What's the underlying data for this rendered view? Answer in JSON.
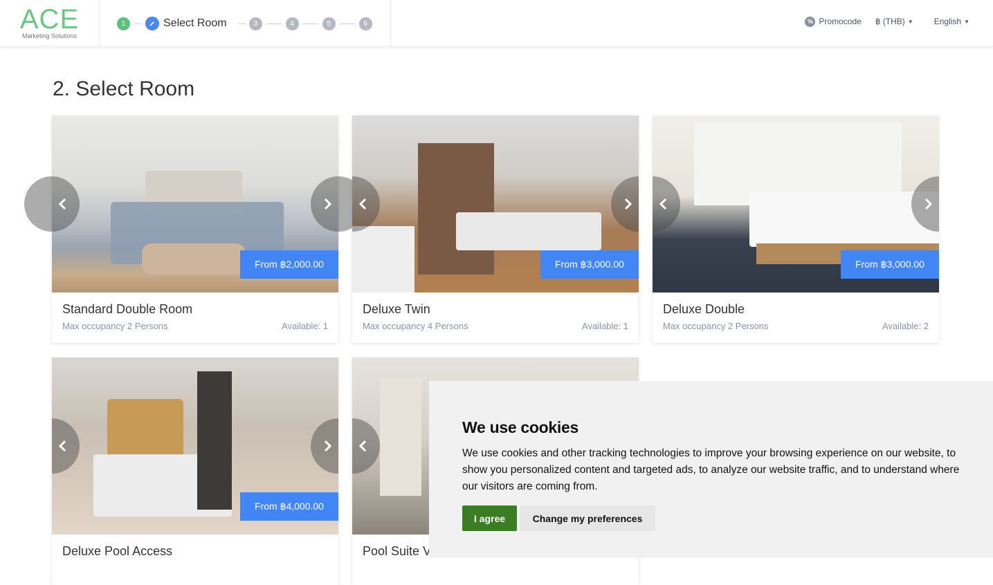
{
  "header": {
    "logo_main": "ACE",
    "logo_sub": "Marketing Solutions",
    "steps": [
      {
        "label": "1",
        "state": "done"
      },
      {
        "label": "Select Room",
        "state": "active"
      },
      {
        "label": "3",
        "state": "todo"
      },
      {
        "label": "4",
        "state": "todo"
      },
      {
        "label": "5",
        "state": "todo"
      },
      {
        "label": "6",
        "state": "todo"
      }
    ],
    "nav": {
      "promocode": "Promocode",
      "currency": "฿ (THB)",
      "language": "English"
    }
  },
  "page": {
    "title": "2. Select Room"
  },
  "rooms": [
    {
      "name": "Standard Double Room",
      "price": "From ฿2,000.00",
      "occupancy": "Max occupancy 2 Persons",
      "available": "Available: 1"
    },
    {
      "name": "Deluxe Twin",
      "price": "From ฿3,000.00",
      "occupancy": "Max occupancy 4 Persons",
      "available": "Available: 1"
    },
    {
      "name": "Deluxe Double",
      "price": "From ฿3,000.00",
      "occupancy": "Max occupancy 2 Persons",
      "available": "Available: 2"
    },
    {
      "name": "Deluxe Pool Access",
      "price": "From ฿4,000.00"
    },
    {
      "name": "Pool Suite V"
    }
  ],
  "cookie": {
    "title": "We use cookies",
    "text": "We use cookies and other tracking technologies to improve your browsing experience on our website, to show you personalized content and targeted ads, to analyze our website traffic, and to understand where our visitors are coming from.",
    "agree": "I agree",
    "preferences": "Change my preferences"
  },
  "colors": {
    "brand_green": "#6cc784",
    "step_done": "#5cc17a",
    "step_active": "#4a87ee",
    "price_badge": "#4285f4",
    "agree_button": "#3a7d22"
  }
}
